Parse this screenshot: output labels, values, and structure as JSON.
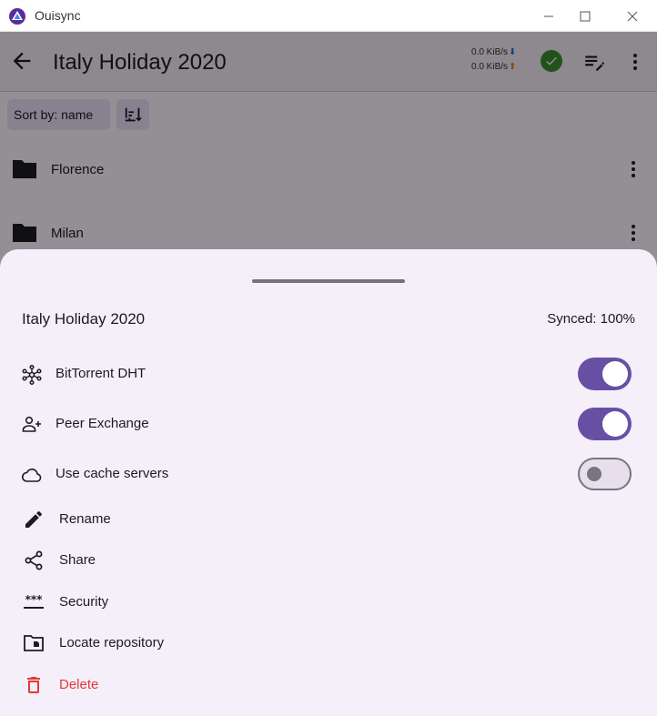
{
  "window": {
    "title": "Ouisync"
  },
  "appbar": {
    "title": "Italy Holiday 2020",
    "download_rate": "0.0 KiB/s",
    "upload_rate": "0.0 KiB/s",
    "download_icon": "arrow-down-icon",
    "upload_icon": "arrow-up-icon",
    "sync_status_icon": "check-circle-icon",
    "sync_status_color": "#3c8d2f"
  },
  "sort": {
    "label": "Sort by: name",
    "order_icon": "sort-descending-icon"
  },
  "folders": [
    {
      "name": "Florence",
      "icon": "folder-icon"
    },
    {
      "name": "Milan",
      "icon": "folder-icon"
    }
  ],
  "sheet": {
    "title": "Italy Holiday 2020",
    "synced": "Synced: 100%",
    "switches": [
      {
        "label": "BitTorrent DHT",
        "icon": "hub-icon",
        "on": true
      },
      {
        "label": "Peer Exchange",
        "icon": "group-add-icon",
        "on": true
      },
      {
        "label": "Use cache servers",
        "icon": "cloud-icon",
        "on": false
      }
    ],
    "actions": [
      {
        "label": "Rename",
        "icon": "pencil-icon"
      },
      {
        "label": "Share",
        "icon": "share-icon"
      },
      {
        "label": "Security",
        "icon": "password-icon"
      },
      {
        "label": "Locate repository",
        "icon": "folder-locate-icon"
      },
      {
        "label": "Delete",
        "icon": "trash-icon",
        "color": "#e53935"
      }
    ]
  },
  "colors": {
    "accent": "#6750a4",
    "sheet_background": "#f4eff8",
    "danger": "#e53935"
  }
}
